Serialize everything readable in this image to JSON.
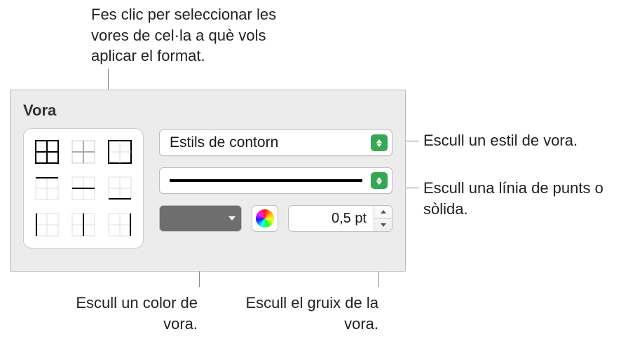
{
  "section_title": "Vora",
  "stroke_style_popup": {
    "label": "Estils de contorn"
  },
  "thickness": {
    "value": "0,5 pt"
  },
  "callouts": {
    "top": "Fes clic per seleccionar les vores de cel·la a què vols aplicar el format.",
    "style": "Escull un estil de vora.",
    "line": "Escull una línia de punts o sòlida.",
    "color": "Escull un color de vora.",
    "thickness": "Escull el gruix de la vora."
  },
  "icons": {
    "style_arrow": "dropdown-arrows-icon",
    "line_arrow": "dropdown-arrows-icon",
    "color_tri": "dropdown-arrow-icon",
    "color_wheel": "color-wheel-icon",
    "step_up": "step-up-icon",
    "step_down": "step-down-icon"
  }
}
